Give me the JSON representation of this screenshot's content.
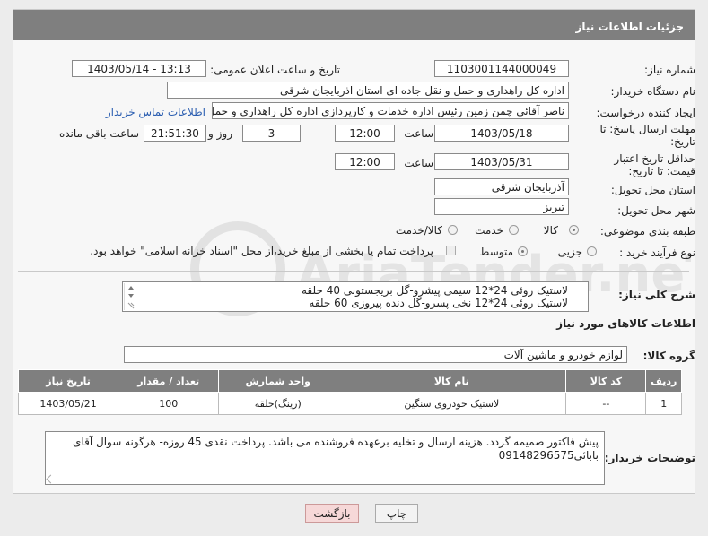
{
  "header": {
    "title": "جزئیات اطلاعات نیاز"
  },
  "form": {
    "need_number_label": "شماره نیاز:",
    "need_number": "1103001144000049",
    "announce_label": "تاریخ و ساعت اعلان عمومی:",
    "announce_value": "1403/05/14 - 13:13",
    "buyer_org_label": "نام دستگاه خریدار:",
    "buyer_org": "اداره کل راهداری و حمل و نقل جاده ای استان اذربایجان شرقی",
    "requester_label": "ایجاد کننده درخواست:",
    "requester": "ناصر آقائی چمن زمین رئیس اداره خدمات و کارپردازی اداره کل راهداری و حمل و",
    "contact_link": "اطلاعات تماس خریدار",
    "reply_deadline_label": "مهلت ارسال پاسخ: تا تاریخ:",
    "reply_date": "1403/05/18",
    "time_label": "ساعت",
    "reply_time": "12:00",
    "days_value": "3",
    "days_label": "روز و",
    "remaining_time": "21:51:30",
    "remaining_label": "ساعت باقی مانده",
    "price_validity_label": "حداقل تاریخ اعتبار قیمت: تا تاریخ:",
    "validity_date": "1403/05/31",
    "validity_time": "12:00",
    "province_label": "استان محل تحویل:",
    "province": "آذربایجان شرقی",
    "city_label": "شهر محل تحویل:",
    "city": "تبریز",
    "category_label": "طبقه بندی موضوعی:",
    "category_options": [
      "کالا",
      "خدمت",
      "کالا/خدمت"
    ],
    "process_label": "نوع فرآیند خرید :",
    "process_options": [
      "جزیی",
      "متوسط"
    ],
    "payment_note": "پرداخت تمام یا بخشی از مبلغ خرید،از محل \"اسناد خزانه اسلامی\" خواهد بود."
  },
  "description": {
    "label": "شرح کلی نیاز:",
    "line1": "لاستیک روئی 24*12 سیمی پیشرو-گل بریجستونی 40 حلقه",
    "line2": "لاستیک روئی 24*12 نخی پسرو-گل دنده پیروزی 60 حلقه"
  },
  "goods_section": {
    "title": "اطلاعات کالاهای مورد نیاز",
    "group_label": "گروه کالا:",
    "group_value": "لوازم خودرو و ماشین آلات"
  },
  "table": {
    "headers": [
      "ردیف",
      "کد کالا",
      "نام کالا",
      "واحد شمارش",
      "تعداد / مقدار",
      "تاریخ نیاز"
    ],
    "rows": [
      [
        "1",
        "--",
        "لاستیک خودروی سنگین",
        "(رینگ)حلقه",
        "100",
        "1403/05/21"
      ]
    ]
  },
  "buyer_notes": {
    "label": "توضیحات خریدار:",
    "text": "پیش فاکتور ضمیمه گردد. هزینه ارسال و تخلیه برعهده فروشنده می باشد. پرداخت نقدی 45 روزه- هرگونه سوال آقای بابائی09148296575"
  },
  "buttons": {
    "print": "چاپ",
    "back": "بازگشت"
  },
  "watermark": {
    "text": "AriaTender.neT"
  },
  "colors": {
    "header_bg": "#7f7f7f",
    "link": "#2a5db0",
    "back_button": "#f6d8d8",
    "print_button": "#f3f3f3"
  }
}
